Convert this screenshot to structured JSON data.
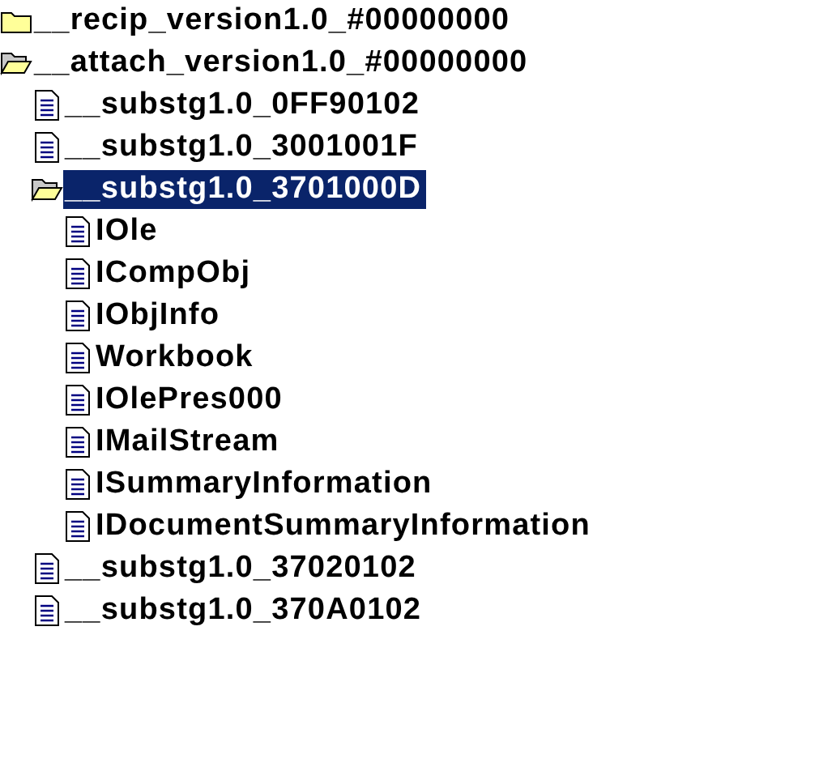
{
  "tree": [
    {
      "label": "__recip_version1.0_#00000000",
      "kind": "folder",
      "expanded": false,
      "selected": false
    },
    {
      "label": "__attach_version1.0_#00000000",
      "kind": "folder",
      "expanded": true,
      "selected": false,
      "children": [
        {
          "label": "__substg1.0_0FF90102",
          "kind": "file",
          "selected": false
        },
        {
          "label": "__substg1.0_3001001F",
          "kind": "file",
          "selected": false
        },
        {
          "label": "__substg1.0_3701000D",
          "kind": "folder",
          "expanded": true,
          "selected": true,
          "children": [
            {
              "label": "IOle",
              "kind": "file",
              "selected": false
            },
            {
              "label": "ICompObj",
              "kind": "file",
              "selected": false
            },
            {
              "label": "IObjInfo",
              "kind": "file",
              "selected": false
            },
            {
              "label": "Workbook",
              "kind": "file",
              "selected": false
            },
            {
              "label": "IOlePres000",
              "kind": "file",
              "selected": false
            },
            {
              "label": "IMailStream",
              "kind": "file",
              "selected": false
            },
            {
              "label": "ISummaryInformation",
              "kind": "file",
              "selected": false
            },
            {
              "label": "IDocumentSummaryInformation",
              "kind": "file",
              "selected": false
            }
          ]
        },
        {
          "label": "__substg1.0_37020102",
          "kind": "file",
          "selected": false
        },
        {
          "label": "__substg1.0_370A0102",
          "kind": "file",
          "selected": false
        }
      ]
    }
  ]
}
